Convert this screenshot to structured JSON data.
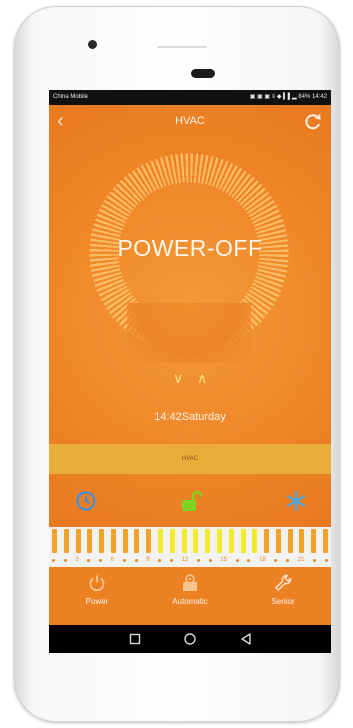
{
  "status_bar": {
    "carrier": "China Mobile",
    "right": "▣ ▣ ▣ ≡ ◆ ▍▌▂ 84% 14:42"
  },
  "header": {
    "title": "HVAC",
    "back_icon": "chevron-left",
    "refresh_icon": "refresh"
  },
  "dial": {
    "status_text": "POWER-OFF"
  },
  "controls": {
    "down_glyph": "∨",
    "up_glyph": "∧"
  },
  "clock": {
    "time_day": "14:42Saturday"
  },
  "mode_bar": {
    "label": "HVAC"
  },
  "icons_row": [
    "timer-icon",
    "unlock-icon",
    "snowflake-icon"
  ],
  "schedule": {
    "hours": [
      "3",
      "6",
      "9",
      "12",
      "15",
      "18",
      "21"
    ],
    "bars_per_segment": 3
  },
  "bottom_nav": {
    "power_label": "Power",
    "auto_label": "Automatic",
    "senior_label": "Senior"
  },
  "colors": {
    "accent": "#ee8426",
    "mode_bar": "#e9ad3a",
    "active_bar": "#f2ea2c",
    "lock_green": "#7ed321",
    "snow_blue": "#3aa8ff"
  }
}
